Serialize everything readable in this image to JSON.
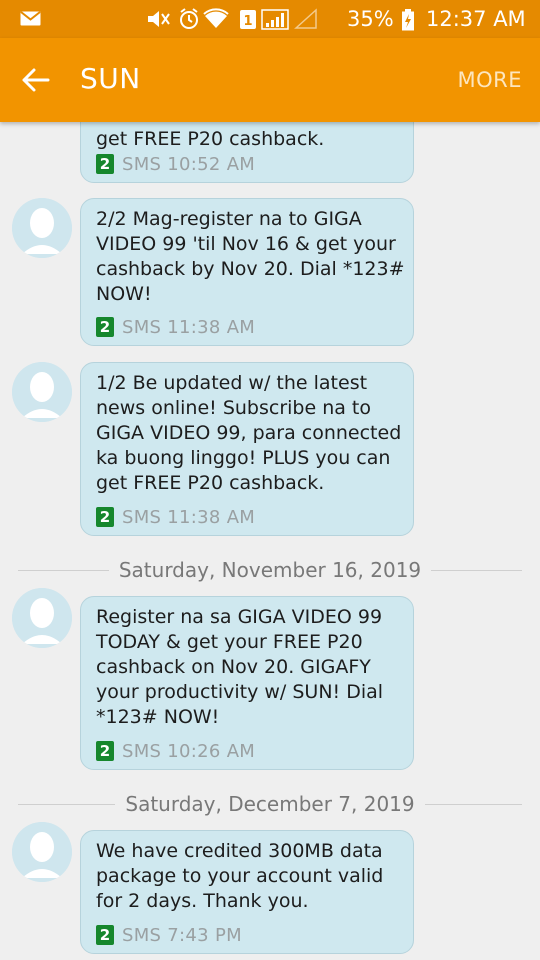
{
  "status_bar": {
    "battery": "35%",
    "time": "12:37 AM",
    "sim_slot": "1",
    "icons": [
      "mail-icon",
      "mute-icon",
      "alarm-icon",
      "wifi-icon",
      "sim-icon",
      "signal-icon",
      "battery-icon"
    ]
  },
  "action_bar": {
    "title": "SUN",
    "more_label": "MORE"
  },
  "messages": [
    {
      "text": "get FREE P20 cashback.",
      "sim": "2",
      "meta": "SMS 10:52 AM"
    },
    {
      "text": "2/2 Mag-register na to GIGA\nVIDEO 99 'til Nov 16 & get your\ncashback by Nov 20. Dial *123#\nNOW!",
      "sim": "2",
      "meta": "SMS 11:38 AM"
    },
    {
      "text": "1/2 Be updated w/ the latest\nnews online! Subscribe na to\nGIGA VIDEO 99, para connected\nka buong linggo! PLUS you can\nget FREE P20 cashback.",
      "sim": "2",
      "meta": "SMS 11:38 AM"
    },
    {
      "text": "Register na sa GIGA VIDEO 99\nTODAY & get your FREE P20\ncashback on Nov 20. GIGAFY\nyour productivity w/ SUN! Dial\n*123# NOW!",
      "sim": "2",
      "meta": "SMS 10:26 AM"
    },
    {
      "text": "We have credited 300MB data\npackage to your account valid\nfor 2 days.  Thank you.",
      "sim": "2",
      "meta": "SMS 7:43 PM"
    }
  ],
  "date_separators": [
    "Saturday, November 16, 2019",
    "Saturday, December 7, 2019"
  ],
  "colors": {
    "status_bar": "#e58a00",
    "action_bar": "#f29400",
    "bubble": "#cfe8ef",
    "sim_badge": "#16872d"
  }
}
